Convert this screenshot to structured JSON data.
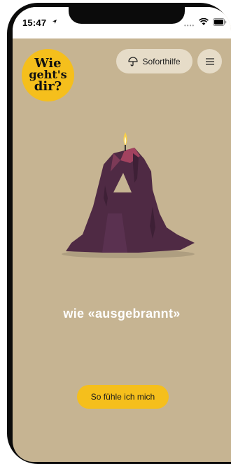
{
  "status_bar": {
    "time": "15:47",
    "more_indicator": "••••"
  },
  "logo": {
    "line1": "Wie",
    "line2": "geht's",
    "line3": "dir?"
  },
  "header": {
    "help_label": "Soforthilfe",
    "help_icon": "umbrella-icon",
    "menu_icon": "menu-icon"
  },
  "main": {
    "illustration": "melting-candle-letter-A",
    "headline": "wie «ausgebrannt»",
    "cta_label": "So fühle ich mich"
  },
  "colors": {
    "background": "#c6b492",
    "accent": "#f5bf1c",
    "pill": "#e6dcc8",
    "candle": "#4f2a44"
  }
}
